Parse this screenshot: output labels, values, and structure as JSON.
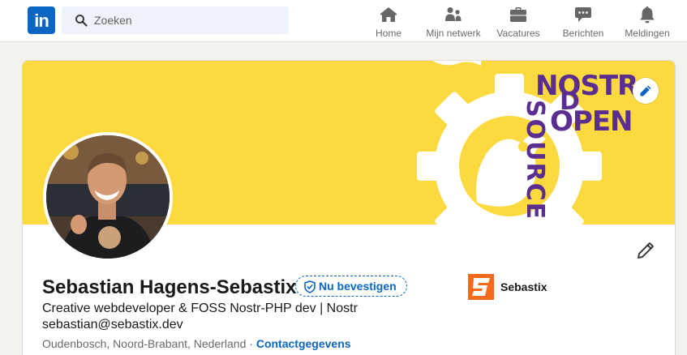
{
  "nav": {
    "logo": "in",
    "search_placeholder": "Zoeken",
    "items": [
      {
        "label": "Home",
        "icon": "home-icon"
      },
      {
        "label": "Mijn netwerk",
        "icon": "network-icon"
      },
      {
        "label": "Vacatures",
        "icon": "briefcase-icon"
      },
      {
        "label": "Berichten",
        "icon": "messages-icon"
      },
      {
        "label": "Meldingen",
        "icon": "bell-icon"
      }
    ]
  },
  "banner": {
    "background": "#fcd93f",
    "art_color": "#5a2d91",
    "words": [
      "NOSTR",
      "D",
      "OPEN",
      "SOURCE"
    ]
  },
  "profile": {
    "name": "Sebastian Hagens-Sebastix",
    "verify_label": "Nu bevestigen",
    "headline": "Creative webdeveloper & FOSS Nostr-PHP dev | Nostr sebastian@sebastix.dev",
    "location": "Oudenbosch, Noord-Brabant, Nederland",
    "separator": "·",
    "contact_label": "Contactgegevens"
  },
  "company": {
    "name": "Sebastix",
    "logo_letter": "S",
    "logo_color": "#f26b1d"
  },
  "colors": {
    "accent": "#0a66c2",
    "page_bg": "#f3f2ef"
  }
}
